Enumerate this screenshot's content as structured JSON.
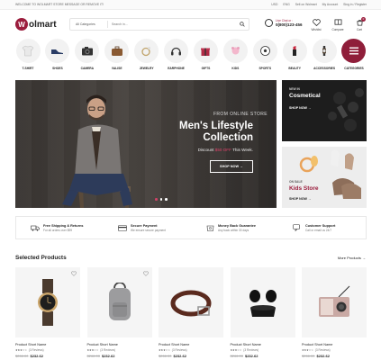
{
  "topbar": {
    "welcome": "WELCOME TO WOLMART STORE MESSAGE OR REMOVE IT!",
    "currency": "USD",
    "language": "ENG",
    "links": [
      "Sell on Wolmart",
      "My Account",
      "Sing in / Register"
    ]
  },
  "header": {
    "logo_text": "olmart",
    "logo_mark": "W",
    "search_category": "All Categories",
    "search_placeholder": "Search in...",
    "live_chat_label": "Live Chat or :",
    "phone": "0(800)123-456",
    "icons": [
      {
        "label": "Wishlist",
        "icon": "heart-icon"
      },
      {
        "label": "Compare",
        "icon": "compare-icon"
      },
      {
        "label": "Cart",
        "icon": "cart-icon",
        "count": "0"
      }
    ]
  },
  "categories": [
    {
      "label": "T-SHIRT",
      "icon": "tshirt-icon"
    },
    {
      "label": "SHOES",
      "icon": "shoe-icon"
    },
    {
      "label": "CAMERA",
      "icon": "camera-icon"
    },
    {
      "label": "VALISE",
      "icon": "valise-icon"
    },
    {
      "label": "JEWELRY",
      "icon": "jewelry-icon"
    },
    {
      "label": "EARPHONE",
      "icon": "earphone-icon"
    },
    {
      "label": "GIFTS",
      "icon": "gift-icon"
    },
    {
      "label": "KIDS",
      "icon": "kids-icon"
    },
    {
      "label": "SPORTS",
      "icon": "sports-icon"
    },
    {
      "label": "BEAUTY",
      "icon": "beauty-icon"
    },
    {
      "label": "ACCESSORIES",
      "icon": "accessories-icon"
    },
    {
      "label": "CATEGORIES",
      "icon": "menu-icon"
    }
  ],
  "hero": {
    "kicker": "FROM ONLINE STORE",
    "title_line1": "Men's Lifestyle",
    "title_line2": "Collection",
    "discount_prefix": "Discount",
    "discount_price": "$50 OFF",
    "discount_suffix": "This Week.",
    "button": "SHOP NOW →"
  },
  "banners": [
    {
      "kicker": "NEW IN",
      "title": "Cosmetical",
      "button": "SHOP NOW →"
    },
    {
      "kicker": "ON SALE",
      "title": "Kids Store",
      "button": "SHOP NOW →"
    }
  ],
  "features": [
    {
      "title": "Free Shipping & Returns",
      "sub": "For all orders over $99",
      "icon": "truck-icon"
    },
    {
      "title": "Secure Payment",
      "sub": "We ensure secure payment",
      "icon": "card-icon"
    },
    {
      "title": "Money Back Guarantee",
      "sub": "Any back within 30 days",
      "icon": "money-back-icon"
    },
    {
      "title": "Customer Support",
      "sub": "Call or email us 24/7",
      "icon": "chat-icon"
    }
  ],
  "products_section": {
    "title": "Selected Products",
    "more": "More Products →",
    "items": [
      {
        "name": "Product Short Name",
        "stars": "★★★☆☆",
        "reviews": "(3 Reviews)",
        "old_price": "$266.00",
        "price": "$232.62",
        "icon": "watch-icon"
      },
      {
        "name": "Product Short Name",
        "stars": "★★★☆☆",
        "reviews": "(3 Reviews)",
        "old_price": "$266.00",
        "price": "$232.62",
        "icon": "backpack-icon"
      },
      {
        "name": "Product Short Name",
        "stars": "★★★☆☆",
        "reviews": "(3 Reviews)",
        "old_price": "$266.00",
        "price": "$232.62",
        "icon": "belt-icon"
      },
      {
        "name": "Product Short Name",
        "stars": "★★★☆☆",
        "reviews": "(3 Reviews)",
        "old_price": "$266.00",
        "price": "$232.62",
        "icon": "earbuds-icon"
      },
      {
        "name": "Product Short Name",
        "stars": "★★★☆☆",
        "reviews": "(3 Reviews)",
        "old_price": "$266.00",
        "price": "$232.62",
        "icon": "radio-icon"
      }
    ]
  },
  "colors": {
    "brand": "#9b1d3d",
    "accent_price": "#e0436c"
  }
}
